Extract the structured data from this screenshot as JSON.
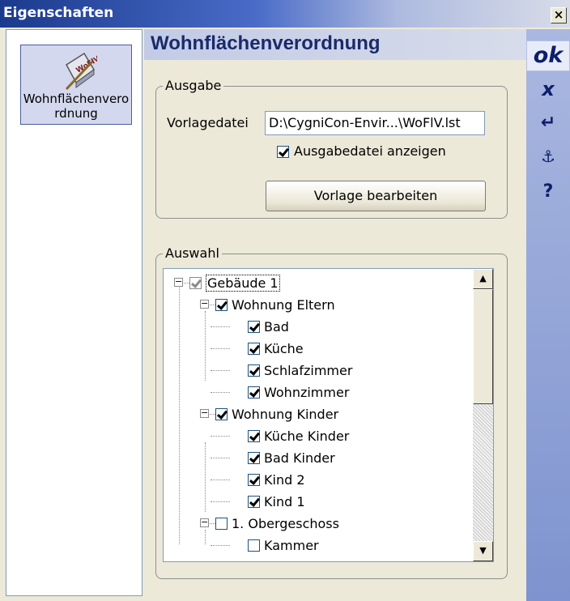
{
  "window": {
    "title": "Eigenschaften",
    "close_symbol": "×"
  },
  "left_panel": {
    "item_label": "Wohnflächenverordnung",
    "item_icon": "wofiv-document-icon"
  },
  "header": {
    "title": "Wohnflächenverordnung"
  },
  "right_toolbar": {
    "ok_label": "ok",
    "cancel_label": "x",
    "apply_symbol": "↵",
    "save_symbol": "⚓",
    "help_label": "?"
  },
  "ausgabe": {
    "group_label": "Ausgabe",
    "vorlage_label": "Vorlagedatei",
    "vorlage_value": "D:\\CygniCon-Envir...\\WoFlV.lst",
    "anzeigen_label": "Ausgabedatei anzeigen",
    "anzeigen_checked": true,
    "edit_button_label": "Vorlage bearbeiten"
  },
  "auswahl": {
    "group_label": "Auswahl",
    "tree": [
      {
        "label": "Gebäude 1",
        "checked": true,
        "level": 0,
        "expander": "−",
        "greyed": true,
        "selected": true
      },
      {
        "label": "Wohnung Eltern",
        "checked": true,
        "level": 1,
        "expander": "−"
      },
      {
        "label": "Bad",
        "checked": true,
        "level": 2
      },
      {
        "label": "Küche",
        "checked": true,
        "level": 2
      },
      {
        "label": "Schlafzimmer",
        "checked": true,
        "level": 2
      },
      {
        "label": "Wohnzimmer",
        "checked": true,
        "level": 2
      },
      {
        "label": "Wohnung Kinder",
        "checked": true,
        "level": 1,
        "expander": "−"
      },
      {
        "label": "Küche Kinder",
        "checked": true,
        "level": 2
      },
      {
        "label": "Bad Kinder",
        "checked": true,
        "level": 2
      },
      {
        "label": "Kind 2",
        "checked": true,
        "level": 2
      },
      {
        "label": "Kind 1",
        "checked": true,
        "level": 2
      },
      {
        "label": "1. Obergeschoss",
        "checked": false,
        "level": 1,
        "expander": "−"
      },
      {
        "label": "Kammer",
        "checked": false,
        "level": 2
      }
    ],
    "scroll_up_symbol": "▲",
    "scroll_down_symbol": "▼"
  }
}
